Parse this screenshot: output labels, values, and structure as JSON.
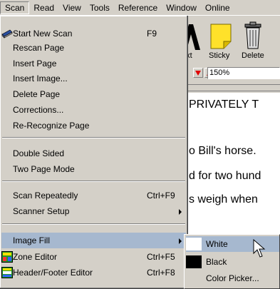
{
  "menubar": {
    "items": [
      {
        "label": "Scan",
        "active": true
      },
      {
        "label": "Read"
      },
      {
        "label": "View"
      },
      {
        "label": "Tools"
      },
      {
        "label": "Reference"
      },
      {
        "label": "Window"
      },
      {
        "label": "Online"
      }
    ]
  },
  "toolbar": {
    "text_label": "ext",
    "sticky_label": "Sticky",
    "delete_label": "Delete",
    "zoom_value": "150%"
  },
  "document": {
    "lines": [
      "PRIVATELY T",
      "o Bill's horse.",
      "d for two hund",
      "s weigh when"
    ]
  },
  "scan_menu": {
    "items": [
      {
        "label": "Start New Scan",
        "shortcut": "F9",
        "icon": "scanner-icon"
      },
      {
        "label": "Rescan Page",
        "shortcut": ""
      },
      {
        "label": "Insert Page",
        "shortcut": ""
      },
      {
        "label": "Insert Image...",
        "shortcut": ""
      },
      {
        "label": "Delete Page",
        "shortcut": ""
      },
      {
        "label": "Corrections...",
        "shortcut": ""
      },
      {
        "label": "Re-Recognize Page",
        "shortcut": ""
      },
      {
        "label": "Double Sided",
        "shortcut": ""
      },
      {
        "label": "Two Page Mode",
        "shortcut": ""
      },
      {
        "label": "Scan Repeatedly",
        "shortcut": "Ctrl+F9"
      },
      {
        "label": "Scanner Setup",
        "shortcut": "",
        "submenu": true
      },
      {
        "label": "Image Fill",
        "shortcut": "",
        "submenu": true,
        "highlighted": true
      },
      {
        "label": "Zone Editor",
        "shortcut": "Ctrl+F5",
        "icon": "zone-editor-icon"
      },
      {
        "label": "Header/Footer Editor",
        "shortcut": "Ctrl+F8",
        "icon": "header-footer-icon"
      }
    ]
  },
  "image_fill_submenu": {
    "items": [
      {
        "label": "White",
        "swatch": "#ffffff",
        "highlighted": true
      },
      {
        "label": "Black",
        "swatch": "#000000"
      },
      {
        "label": "Color Picker...",
        "swatch": ""
      }
    ]
  },
  "colors": {
    "menu_bg": "#d4d0c8",
    "highlight": "#a6b8cf",
    "arrow_red": "#e00000"
  }
}
